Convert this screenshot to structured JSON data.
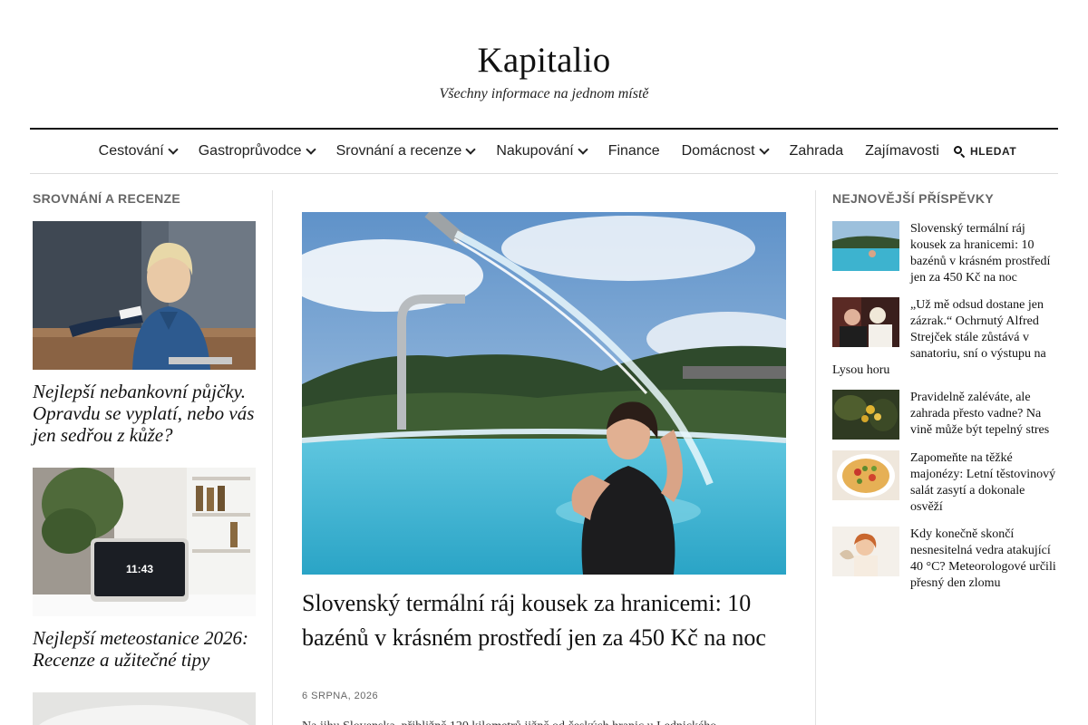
{
  "site": {
    "title": "Kapitalio",
    "tagline": "Všechny informace na jednom místě"
  },
  "nav": {
    "items": [
      {
        "label": "Cestování",
        "has_dropdown": true
      },
      {
        "label": "Gastroprůvodce",
        "has_dropdown": true
      },
      {
        "label": "Srovnání a recenze",
        "has_dropdown": true
      },
      {
        "label": "Nakupování",
        "has_dropdown": true
      },
      {
        "label": "Finance",
        "has_dropdown": false
      },
      {
        "label": "Domácnost",
        "has_dropdown": true
      },
      {
        "label": "Zahrada",
        "has_dropdown": false
      },
      {
        "label": "Zajímavosti",
        "has_dropdown": false
      }
    ],
    "search_label": "HLEDAT",
    "search_icon": "search-icon"
  },
  "left": {
    "section_label": "SROVNÁNÍ A RECENZE",
    "articles": [
      {
        "title": "Nejlepší nebankovní půjčky. Opravdu se vyplatí, nebo vás jen sedřou z kůže?"
      },
      {
        "title": "Nejlepší meteostanice 2026: Recenze a užitečné tipy"
      }
    ],
    "clock_text": "11:43"
  },
  "main": {
    "title": "Slovenský termální ráj kousek za hranicemi: 10 bazénů v krásném prostředí jen za 450 Kč na noc",
    "date": "6 SRPNA, 2026",
    "excerpt": "Na jihu Slovenska, přibližně 120 kilometrů jižně od českých hranic u Lednického"
  },
  "right": {
    "section_label": "NEJNOVĚJŠÍ PŘÍSPĚVKY",
    "posts": [
      {
        "title": "Slovenský termální ráj kousek za hranicemi: 10 bazénů v krásném prostředí jen za 450 Kč na noc"
      },
      {
        "title": "„Už mě odsud dostane jen zázrak.“ Ochrnutý Alfred Strejček stále zůstává v sanatoriu, sní o výstupu na Lysou horu"
      },
      {
        "title": "Pravidelně zaléváte, ale zahrada přesto vadne? Na vině může být tepelný stres"
      },
      {
        "title": "Zapomeňte na těžké majonézy: Letní těstovinový salát zasytí a dokonale osvěží"
      },
      {
        "title": "Kdy konečně skončí nesnesitelná vedra atakující 40 °C? Meteorologové určili přesný den zlomu"
      }
    ]
  },
  "colors": {
    "text": "#111111",
    "muted_label": "#666666",
    "divider": "#e2e2e2",
    "rule": "#111111"
  }
}
